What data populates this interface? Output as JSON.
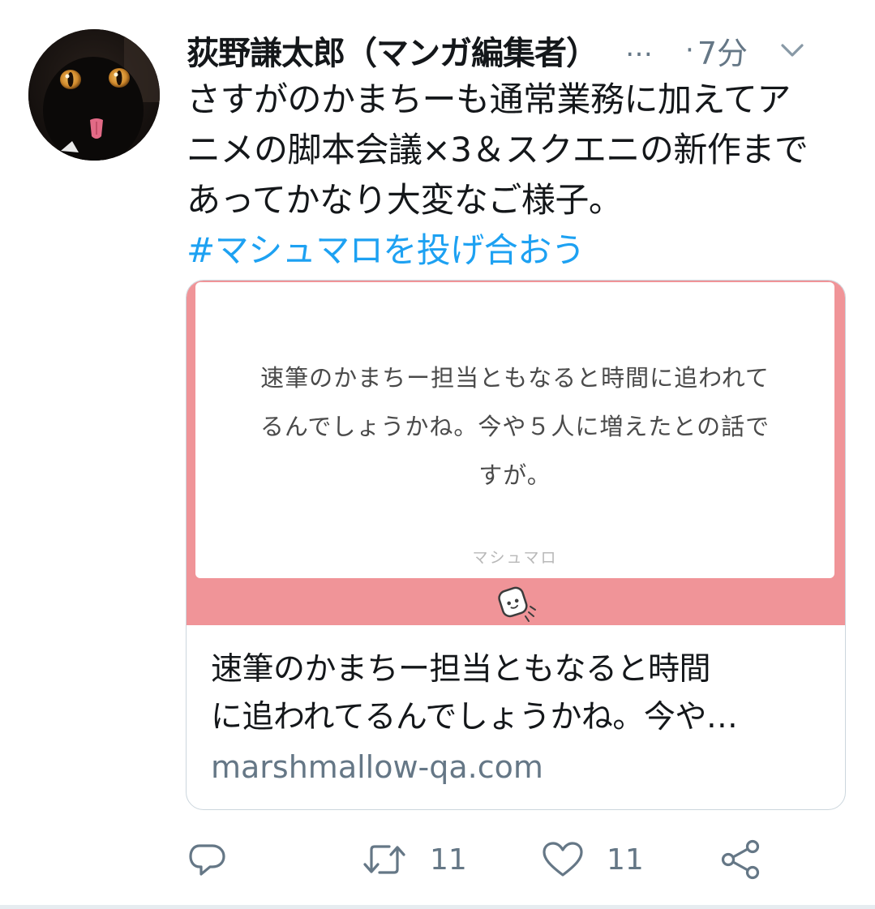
{
  "tweet": {
    "author_name": "荻野謙太郎（マンガ編集者）",
    "name_truncation": "…",
    "time_separator": "·",
    "time": "7分",
    "text_lines": [
      "さすがのかまちーも通常業務に加えてア",
      "ニメの脚本会議×3＆スクエニの新作まで",
      "あってかなり大変なご様子。"
    ],
    "hashtag": "#マシュマロを投げ合おう"
  },
  "card": {
    "image_question_lines": [
      "速筆のかまちー担当ともなると時間に追われて",
      "るんでしょうかね。今や５人に増えたとの話で",
      "すが。"
    ],
    "image_brand": "マシュマロ",
    "title_lines": [
      "速筆のかまちー担当ともなると時間",
      "に追われてるんでしょうかね。今や…"
    ],
    "domain": "marshmallow-qa.com"
  },
  "actions": {
    "reply_icon": "reply-icon",
    "retweet_icon": "retweet-icon",
    "retweet_count": "11",
    "like_icon": "heart-icon",
    "like_count": "11",
    "share_icon": "share-icon"
  },
  "colors": {
    "text": "#14171a",
    "secondary": "#657786",
    "link": "#1da1f2",
    "card_pink": "#f09498",
    "border": "#ccd6dd"
  }
}
